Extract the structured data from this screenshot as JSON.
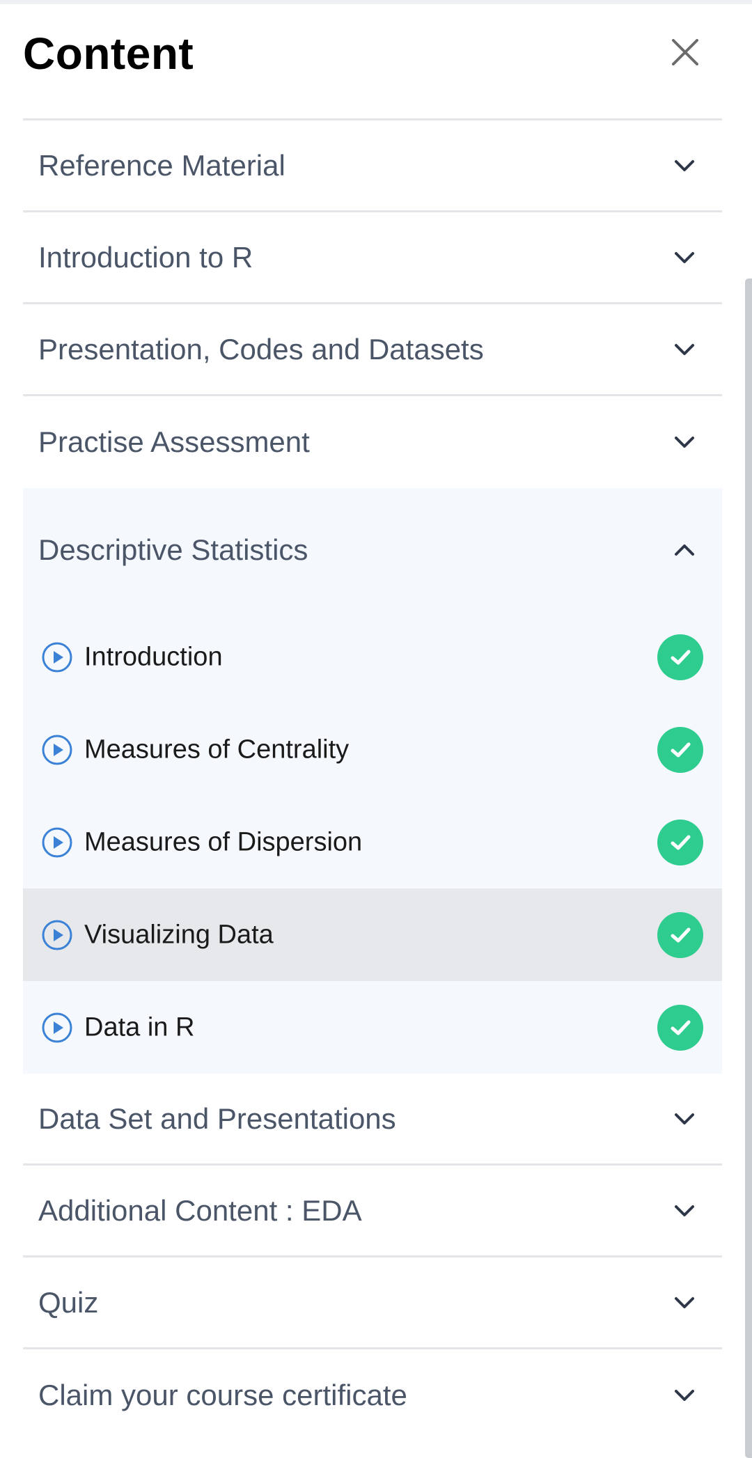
{
  "header": {
    "title": "Content",
    "close_icon": "close-icon"
  },
  "sections_before": [
    {
      "label": "Reference Material",
      "icon": "chevron-down-icon"
    },
    {
      "label": "Introduction to R",
      "icon": "chevron-down-icon"
    },
    {
      "label": "Presentation, Codes and Datasets",
      "icon": "chevron-down-icon"
    },
    {
      "label": "Practise Assessment",
      "icon": "chevron-down-icon"
    }
  ],
  "expanded_section": {
    "label": "Descriptive Statistics",
    "icon": "chevron-up-icon",
    "lessons": [
      {
        "label": "Introduction",
        "icon": "play-circle-icon",
        "status_icon": "check-circle-icon",
        "completed": true,
        "active": false
      },
      {
        "label": "Measures of Centrality",
        "icon": "play-circle-icon",
        "status_icon": "check-circle-icon",
        "completed": true,
        "active": false
      },
      {
        "label": "Measures of Dispersion",
        "icon": "play-circle-icon",
        "status_icon": "check-circle-icon",
        "completed": true,
        "active": false
      },
      {
        "label": "Visualizing Data",
        "icon": "play-circle-icon",
        "status_icon": "check-circle-icon",
        "completed": true,
        "active": true
      },
      {
        "label": "Data in R",
        "icon": "play-circle-icon",
        "status_icon": "check-circle-icon",
        "completed": true,
        "active": false
      }
    ]
  },
  "sections_after": [
    {
      "label": "Data Set and Presentations",
      "icon": "chevron-down-icon"
    },
    {
      "label": "Additional Content : EDA",
      "icon": "chevron-down-icon"
    },
    {
      "label": "Quiz",
      "icon": "chevron-down-icon"
    },
    {
      "label": "Claim your course certificate",
      "icon": "chevron-down-icon"
    }
  ],
  "colors": {
    "section_text": "#4a5568",
    "expanded_bg": "#f5f9fe",
    "active_bg": "#e6e8ec",
    "check_green": "#2ecc8f",
    "play_blue": "#3b82d6",
    "divider": "#e3e5e8"
  }
}
